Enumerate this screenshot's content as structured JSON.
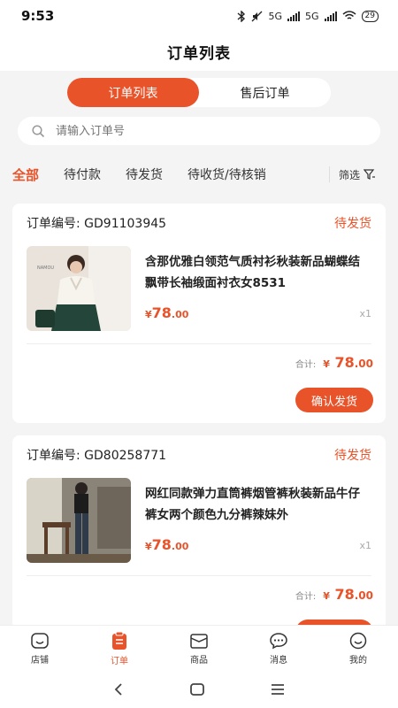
{
  "status": {
    "time": "9:53",
    "sig1": "5G",
    "sig2": "5G",
    "battery": "29"
  },
  "header": {
    "title": "订单列表"
  },
  "segments": [
    {
      "label": "订单列表",
      "active": true
    },
    {
      "label": "售后订单",
      "active": false
    }
  ],
  "search": {
    "placeholder": "请输入订单号"
  },
  "tabs": [
    {
      "label": "全部",
      "active": true
    },
    {
      "label": "待付款"
    },
    {
      "label": "待发货"
    },
    {
      "label": "待收货/待核销"
    }
  ],
  "filter": {
    "label": "筛选"
  },
  "orders": [
    {
      "order_no": "订单编号: GD91103945",
      "status": "待发货",
      "product_name": "含那优雅白领范气质衬衫秋装新品蝴蝶结飘带长袖缎面衬衣女8531",
      "price_currency": "¥",
      "price_int": "78",
      "price_dec": ".00",
      "qty": "x1",
      "total_label": "合计:",
      "total_currency": "¥",
      "total_int": "78",
      "total_dec": ".00",
      "action": "确认发货"
    },
    {
      "order_no": "订单编号: GD80258771",
      "status": "待发货",
      "product_name": "网红同款弹力直筒裤烟管裤秋装新品牛仔裤女两个颜色九分裤辣妹外",
      "price_currency": "¥",
      "price_int": "78",
      "price_dec": ".00",
      "qty": "x1",
      "total_label": "合计:",
      "total_currency": "¥",
      "total_int": "78",
      "total_dec": ".00"
    }
  ],
  "bottom_nav": [
    {
      "label": "店铺",
      "icon": "store-icon"
    },
    {
      "label": "订单",
      "icon": "order-icon",
      "active": true
    },
    {
      "label": "商品",
      "icon": "product-icon"
    },
    {
      "label": "消息",
      "icon": "message-icon"
    },
    {
      "label": "我的",
      "icon": "profile-icon"
    }
  ],
  "colors": {
    "accent": "#e8532a",
    "background": "#f4f4f4"
  }
}
